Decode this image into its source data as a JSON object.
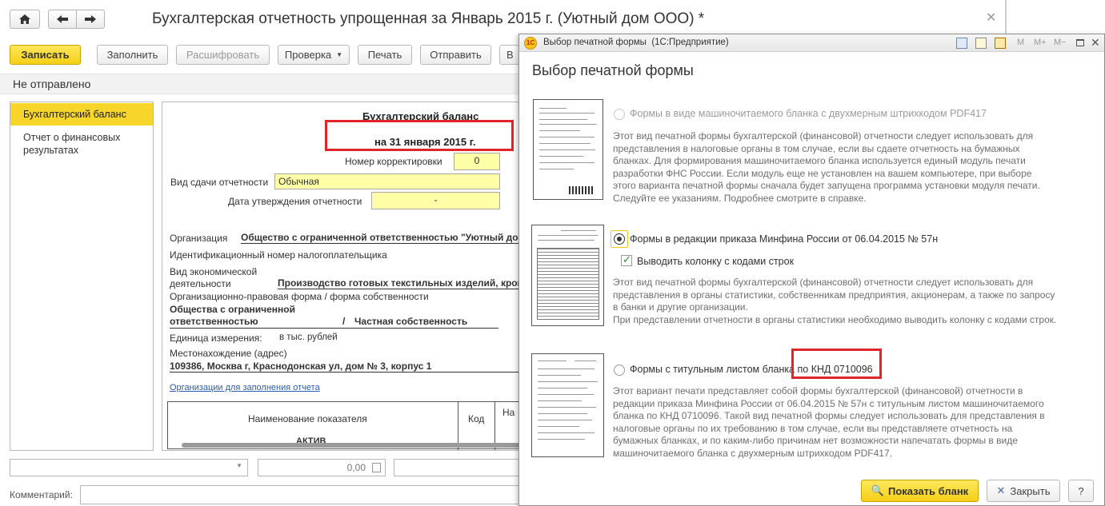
{
  "main_window": {
    "title": "Бухгалтерская отчетность упрощенная за Январь 2015 г. (Уютный дом ООО) *",
    "toolbar": {
      "save": "Записать",
      "fill": "Заполнить",
      "decode": "Расшифровать",
      "check": "Проверка",
      "print": "Печать",
      "send": "Отправить",
      "more": "В"
    },
    "status": "Не отправлено",
    "sections": [
      "Бухгалтерский баланс",
      "Отчет о финансовых результатах"
    ],
    "form": {
      "heading": "Бухгалтерский баланс",
      "date": "на 31 января 2015 г.",
      "correction_label": "Номер корректировки",
      "correction_value": "0",
      "submission_type_label": "Вид сдачи отчетности",
      "submission_type_value": "Обычная",
      "approval_date_label": "Дата утверждения отчетности",
      "approval_date_value": "-",
      "org_label": "Организация",
      "org_value": "Общество с ограниченной ответственностью \"Уютный дом",
      "inn_label": "Идентификационный номер налогоплательщика",
      "activity_label_1": "Вид экономической",
      "activity_label_2": "деятельности",
      "activity_value": "Производство готовых текстильных изделий, кром",
      "legal_form_label": "Организационно-правовая форма / форма собственности",
      "legal_form_value_1": "Общества с ограниченной",
      "legal_form_value_2": "ответственностью",
      "slash": "/",
      "ownership_value": "Частная собственность",
      "unit_label": "Единица измерения:",
      "unit_value": "в тыс. рублей",
      "address_label": "Местонахождение (адрес)",
      "address_value": "109386, Москва г, Краснодонская ул, дом № 3, корпус 1",
      "orgs_link": "Организации для заполнения отчета",
      "table_headers": [
        "Наименование показателя",
        "Код",
        "На"
      ],
      "table_first_row": "АКТИВ"
    },
    "bottom": {
      "amount": "0,00",
      "comment_label": "Комментарий:"
    }
  },
  "dialog": {
    "title": "Выбор печатной формы  (1С:Предприятие)",
    "title_tools": [
      "M",
      "M+",
      "M−"
    ],
    "heading": "Выбор печатной формы",
    "options": [
      {
        "label": "Формы в виде машиночитаемого бланка с двухмерным штрихкодом PDF417",
        "selected": false,
        "enabled": false,
        "description": [
          "Этот вид печатной формы бухгалтерской (финансовой) отчетности следует использовать для",
          "представления в налоговые органы в том случае, если вы сдаете отчетность на бумажных",
          "бланках. Для формирования машиночитаемого бланка используется единый модуль печати",
          "разработки ФНС России. Если модуль еще не установлен на вашем компьютере, при выборе",
          "этого варианта печатной формы сначала будет запущена программа установки модуля печати.",
          "Следуйте ее указаниям. Подробнее смотрите в справке."
        ]
      },
      {
        "label": "Формы в редакции приказа Минфина России от 06.04.2015 № 57н",
        "selected": true,
        "enabled": true,
        "checkbox_label": "Выводить колонку с кодами строк",
        "checkbox_checked": true,
        "description": [
          "Этот вид печатной формы бухгалтерской (финансовой) отчетности следует использовать для",
          "представления в органы статистики, собственникам предприятия, акционерам, а также по запросу",
          "в банки и другие организации.",
          "При представлении отчетности в органы статистики необходимо выводить колонку с кодами строк."
        ]
      },
      {
        "label": "Формы с титульным листом бланка по КНД 0710096",
        "selected": false,
        "enabled": true,
        "description": [
          "Этот вариант печати представляет собой формы бухгалтерской (финансовой) отчетности в",
          "редакции приказа Минфина России от 06.04.2015 № 57н с титульным листом машиночитаемого",
          "бланка по КНД 0710096. Такой вид печатной формы следует использовать для представления в",
          "налоговые органы по их требованию в том случае, если вы представляете отчетность на",
          "бумажных бланках, и по каким-либо причинам нет возможности напечатать формы в виде",
          "машиночитаемого бланка с двухмерным штрихкодом PDF417."
        ]
      }
    ],
    "show_button": "Показать бланк",
    "close_button": "Закрыть",
    "help_button": "?"
  },
  "colors": {
    "accent_yellow": "#f5cf16",
    "highlight_red": "#e0252a",
    "field_yellow": "#ffffa8",
    "link_blue": "#2a5db0"
  }
}
